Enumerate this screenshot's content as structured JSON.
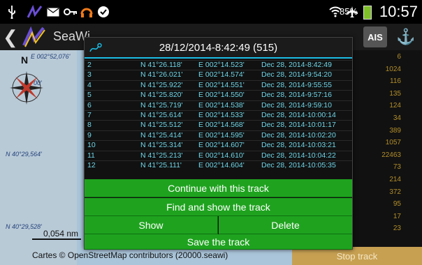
{
  "statusbar": {
    "battery": "85%",
    "time": "10:57",
    "icons": [
      "usb-icon",
      "seawi-notify-icon",
      "mail-icon",
      "key-icon",
      "headphones-icon",
      "check-icon",
      "wifi-icon",
      "airplane-icon",
      "battery-icon"
    ]
  },
  "actionbar": {
    "title": "SeaWi",
    "ais_label": "AIS"
  },
  "map": {
    "north": "N",
    "lon_label": "E 002°52,076'",
    "lat_label_top": "00'",
    "lat_label_mid": "N 40°29,564'",
    "lat_label_bottom": "N 40°29,528'",
    "scale": "0,054 nm",
    "credit": "Cartes © OpenStreetMap contributors (20000.seawi)"
  },
  "rightcol": {
    "values": [
      "6",
      "1024",
      "116",
      "135",
      "124",
      "34",
      "389",
      "1057",
      "22463",
      "73",
      "214",
      "372",
      "95",
      "17",
      "23"
    ],
    "stop_label": "Stop track"
  },
  "dialog": {
    "title": "28/12/2014-8:42:49   (515)",
    "rows": [
      {
        "id": "2",
        "lat": "N 41°26.118'",
        "lon": "E 002°14.523'",
        "date": "Dec 28, 2014-8:42:49"
      },
      {
        "id": "3",
        "lat": "N 41°26.021'",
        "lon": "E 002°14.574'",
        "date": "Dec 28, 2014-9:54:20"
      },
      {
        "id": "4",
        "lat": "N 41°25.922'",
        "lon": "E 002°14.551'",
        "date": "Dec 28, 2014-9:55:55"
      },
      {
        "id": "5",
        "lat": "N 41°25.820'",
        "lon": "E 002°14.550'",
        "date": "Dec 28, 2014-9:57:16"
      },
      {
        "id": "6",
        "lat": "N 41°25.719'",
        "lon": "E 002°14.538'",
        "date": "Dec 28, 2014-9:59:10"
      },
      {
        "id": "7",
        "lat": "N 41°25.614'",
        "lon": "E 002°14.533'",
        "date": "Dec 28, 2014-10:00:14"
      },
      {
        "id": "8",
        "lat": "N 41°25.512'",
        "lon": "E 002°14.568'",
        "date": "Dec 28, 2014-10:01:17"
      },
      {
        "id": "9",
        "lat": "N 41°25.414'",
        "lon": "E 002°14.595'",
        "date": "Dec 28, 2014-10:02:20"
      },
      {
        "id": "10",
        "lat": "N 41°25.314'",
        "lon": "E 002°14.607'",
        "date": "Dec 28, 2014-10:03:21"
      },
      {
        "id": "11",
        "lat": "N 41°25.213'",
        "lon": "E 002°14.610'",
        "date": "Dec 28, 2014-10:04:22"
      },
      {
        "id": "12",
        "lat": "N 41°25.111'",
        "lon": "E 002°14.604'",
        "date": "Dec 28, 2014-10:05:35"
      }
    ],
    "buttons": {
      "continue": "Continue with this track",
      "find": "Find and show the track",
      "show": "Show",
      "delete": "Delete",
      "save": "Save the track"
    }
  },
  "colors": {
    "accent": "#1bbde6",
    "button_green": "#1fa31f",
    "row_text": "#6fd6e8",
    "stop_bar": "#c7a052"
  }
}
